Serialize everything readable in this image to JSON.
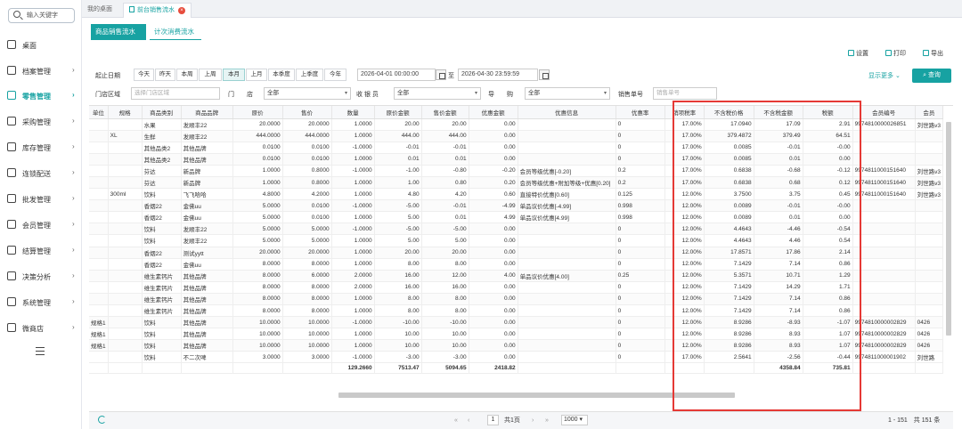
{
  "sidebar": {
    "search_placeholder": "输入关键字",
    "items": [
      {
        "label": "桌面"
      },
      {
        "label": "档案管理"
      },
      {
        "label": "零售管理"
      },
      {
        "label": "采购管理"
      },
      {
        "label": "库存管理"
      },
      {
        "label": "连锁配送"
      },
      {
        "label": "批发管理"
      },
      {
        "label": "会员管理"
      },
      {
        "label": "结算管理"
      },
      {
        "label": "决策分析"
      },
      {
        "label": "系统管理"
      },
      {
        "label": "微商店"
      }
    ]
  },
  "tabs": {
    "home": "我的桌面",
    "active": "前台销售流水"
  },
  "subtabs": {
    "goods": "商品销售流水",
    "count": "计次消费流水"
  },
  "toolbar": {
    "settings": "设置",
    "print": "打印",
    "export": "导出"
  },
  "filters": {
    "stat_date_label": "起止日期",
    "date_buttons": [
      "今天",
      "昨天",
      "本周",
      "上周",
      "本月",
      "上月",
      "本季度",
      "上季度",
      "今年"
    ],
    "date_from": "2026-04-01 00:00:00",
    "to_label": "至",
    "date_to": "2026-04-30 23:59:59",
    "show_more": "显示更多",
    "query": "查询",
    "store_area_label": "门店区域",
    "store_area_placeholder": "选择门店区域",
    "store_label": "门　　店",
    "store_value": "全部",
    "cashier_label": "收 银 员",
    "cashier_value": "全部",
    "guide_label": "导　　购",
    "guide_value": "全部",
    "order_label": "销售单号",
    "order_placeholder": "销售单号"
  },
  "table": {
    "headers": [
      "单位",
      "规格",
      "商品类别",
      "商品品牌",
      "原价",
      "售价",
      "数量",
      "原价金额",
      "售价金额",
      "优惠金额",
      "优惠信息",
      "优惠率",
      "销项税率",
      "不含税价格",
      "不含税金额",
      "税额",
      "会员编号",
      "会员"
    ],
    "rows": [
      [
        "",
        "",
        "水果",
        "发顺丰22",
        "20.0000",
        "20.0000",
        "1.0000",
        "20.00",
        "20.00",
        "0.00",
        "",
        "0",
        "17.00%",
        "17.0940",
        "17.09",
        "2.91",
        "9974810000026851",
        "刘世路v3"
      ],
      [
        "",
        "XL",
        "生鲜",
        "发顺丰22",
        "444.0000",
        "444.0000",
        "1.0000",
        "444.00",
        "444.00",
        "0.00",
        "",
        "0",
        "17.00%",
        "379.4872",
        "379.49",
        "64.51",
        "",
        ""
      ],
      [
        "",
        "",
        "其他品类2",
        "其他品牌",
        "0.0100",
        "0.0100",
        "-1.0000",
        "-0.01",
        "-0.01",
        "0.00",
        "",
        "0",
        "17.00%",
        "0.0085",
        "-0.01",
        "-0.00",
        "",
        ""
      ],
      [
        "",
        "",
        "其他品类2",
        "其他品牌",
        "0.0100",
        "0.0100",
        "1.0000",
        "0.01",
        "0.01",
        "0.00",
        "",
        "0",
        "17.00%",
        "0.0085",
        "0.01",
        "0.00",
        "",
        ""
      ],
      [
        "",
        "",
        "芬达",
        "新品牌",
        "1.0000",
        "0.8000",
        "-1.0000",
        "-1.00",
        "-0.80",
        "-0.20",
        "会员等级优惠[-0.20]",
        "0.2",
        "17.00%",
        "0.6838",
        "-0.68",
        "-0.12",
        "9974811000151640",
        "刘世路v3"
      ],
      [
        "",
        "",
        "芬达",
        "新品牌",
        "1.0000",
        "0.8000",
        "1.0000",
        "1.00",
        "0.80",
        "0.20",
        "会员等级优惠+附加等级+优惠[0.20]",
        "0.2",
        "17.00%",
        "0.6838",
        "0.68",
        "0.12",
        "9974811000151640",
        "刘世路v3"
      ],
      [
        "",
        "300ml",
        "饮料",
        "飞飞哈哈",
        "4.8000",
        "4.2000",
        "1.0000",
        "4.80",
        "4.20",
        "0.60",
        "直接特价优惠[0.60]",
        "0.125",
        "12.00%",
        "3.7500",
        "3.75",
        "0.45",
        "9974811000151640",
        "刘世路v3"
      ],
      [
        "",
        "",
        "香烟22",
        "金佛uu",
        "5.0000",
        "0.0100",
        "-1.0000",
        "-5.00",
        "-0.01",
        "-4.99",
        "单品议价优惠[-4.99]",
        "0.998",
        "12.00%",
        "0.0089",
        "-0.01",
        "-0.00",
        "",
        ""
      ],
      [
        "",
        "",
        "香烟22",
        "金佛uu",
        "5.0000",
        "0.0100",
        "1.0000",
        "5.00",
        "0.01",
        "4.99",
        "单品议价优惠[4.99]",
        "0.998",
        "12.00%",
        "0.0089",
        "0.01",
        "0.00",
        "",
        ""
      ],
      [
        "",
        "",
        "饮料",
        "发顺丰22",
        "5.0000",
        "5.0000",
        "-1.0000",
        "-5.00",
        "-5.00",
        "0.00",
        "",
        "0",
        "12.00%",
        "4.4643",
        "-4.46",
        "-0.54",
        "",
        ""
      ],
      [
        "",
        "",
        "饮料",
        "发顺丰22",
        "5.0000",
        "5.0000",
        "1.0000",
        "5.00",
        "5.00",
        "0.00",
        "",
        "0",
        "12.00%",
        "4.4643",
        "4.46",
        "0.54",
        "",
        ""
      ],
      [
        "",
        "",
        "香烟22",
        "测试yytt",
        "20.0000",
        "20.0000",
        "1.0000",
        "20.00",
        "20.00",
        "0.00",
        "",
        "0",
        "12.00%",
        "17.8571",
        "17.86",
        "2.14",
        "",
        ""
      ],
      [
        "",
        "",
        "香烟22",
        "金佛uu",
        "8.0000",
        "8.0000",
        "1.0000",
        "8.00",
        "8.00",
        "0.00",
        "",
        "0",
        "12.00%",
        "7.1429",
        "7.14",
        "0.86",
        "",
        ""
      ],
      [
        "",
        "",
        "维生素钙片",
        "其他品牌",
        "8.0000",
        "6.0000",
        "2.0000",
        "16.00",
        "12.00",
        "4.00",
        "单品议价优惠[4.00]",
        "0.25",
        "12.00%",
        "5.3571",
        "10.71",
        "1.29",
        "",
        ""
      ],
      [
        "",
        "",
        "维生素钙片",
        "其他品牌",
        "8.0000",
        "8.0000",
        "2.0000",
        "16.00",
        "16.00",
        "0.00",
        "",
        "0",
        "12.00%",
        "7.1429",
        "14.29",
        "1.71",
        "",
        ""
      ],
      [
        "",
        "",
        "维生素钙片",
        "其他品牌",
        "8.0000",
        "8.0000",
        "1.0000",
        "8.00",
        "8.00",
        "0.00",
        "",
        "0",
        "12.00%",
        "7.1429",
        "7.14",
        "0.86",
        "",
        ""
      ],
      [
        "",
        "",
        "维生素钙片",
        "其他品牌",
        "8.0000",
        "8.0000",
        "1.0000",
        "8.00",
        "8.00",
        "0.00",
        "",
        "0",
        "12.00%",
        "7.1429",
        "7.14",
        "0.86",
        "",
        ""
      ],
      [
        "规格1",
        "",
        "饮料",
        "其他品牌",
        "10.0000",
        "10.0000",
        "-1.0000",
        "-10.00",
        "-10.00",
        "0.00",
        "",
        "0",
        "12.00%",
        "8.9286",
        "-8.93",
        "-1.07",
        "9974810000002829",
        "0426"
      ],
      [
        "规格1",
        "",
        "饮料",
        "其他品牌",
        "10.0000",
        "10.0000",
        "1.0000",
        "10.00",
        "10.00",
        "0.00",
        "",
        "0",
        "12.00%",
        "8.9286",
        "8.93",
        "1.07",
        "9974810000002829",
        "0426"
      ],
      [
        "规格1",
        "",
        "饮料",
        "其他品牌",
        "10.0000",
        "10.0000",
        "1.0000",
        "10.00",
        "10.00",
        "0.00",
        "",
        "0",
        "12.00%",
        "8.9286",
        "8.93",
        "1.07",
        "9974810000002829",
        "0426"
      ],
      [
        "",
        "",
        "饮料",
        "不二次啤",
        "3.0000",
        "3.0000",
        "-1.0000",
        "-3.00",
        "-3.00",
        "0.00",
        "",
        "0",
        "17.00%",
        "2.5641",
        "-2.56",
        "-0.44",
        "9974811000001902",
        "刘世路"
      ]
    ],
    "totals": [
      "",
      "",
      "",
      "",
      "",
      "",
      "129.2660",
      "7513.47",
      "5094.65",
      "2418.82",
      "",
      "",
      "",
      "",
      "4358.84",
      "735.81",
      "",
      ""
    ]
  },
  "pager": {
    "first": "«",
    "prev": "‹",
    "page": "1",
    "of": "共1页",
    "next": "›",
    "last": "»",
    "size": "1000",
    "summary": "1 - 151　共 151 条"
  }
}
